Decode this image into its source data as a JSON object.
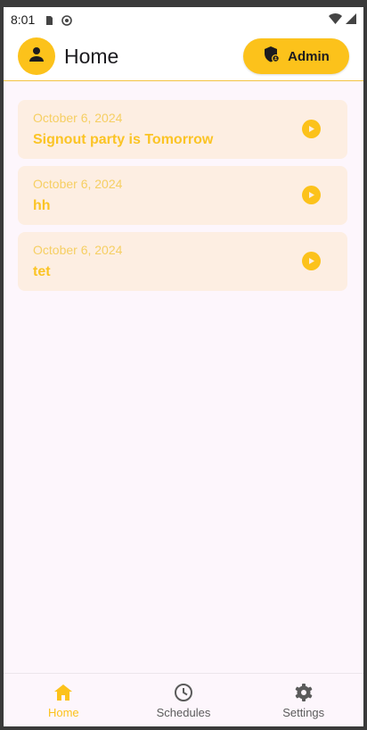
{
  "status_bar": {
    "time": "8:01",
    "icons": [
      "sim-card-icon",
      "app-notification-icon",
      "wifi-icon",
      "signal-icon"
    ]
  },
  "app_bar": {
    "title": "Home",
    "avatar_icon": "person-icon",
    "admin_button": {
      "label": "Admin",
      "icon": "shield-admin-icon"
    }
  },
  "announcements": [
    {
      "date": "October 6, 2024",
      "title": "Signout party is Tomorrow",
      "icon": "play-circle-icon"
    },
    {
      "date": "October 6, 2024",
      "title": "hh",
      "icon": "play-circle-icon"
    },
    {
      "date": "October 6, 2024",
      "title": "tet",
      "icon": "play-circle-icon"
    }
  ],
  "bottom_nav": {
    "items": [
      {
        "label": "Home",
        "icon": "home-icon",
        "active": true
      },
      {
        "label": "Schedules",
        "icon": "clock-icon",
        "active": false
      },
      {
        "label": "Settings",
        "icon": "gear-icon",
        "active": false
      }
    ]
  },
  "colors": {
    "accent": "#fcc21b",
    "card_background": "#fdeee2",
    "page_background": "#fdf6fc"
  }
}
